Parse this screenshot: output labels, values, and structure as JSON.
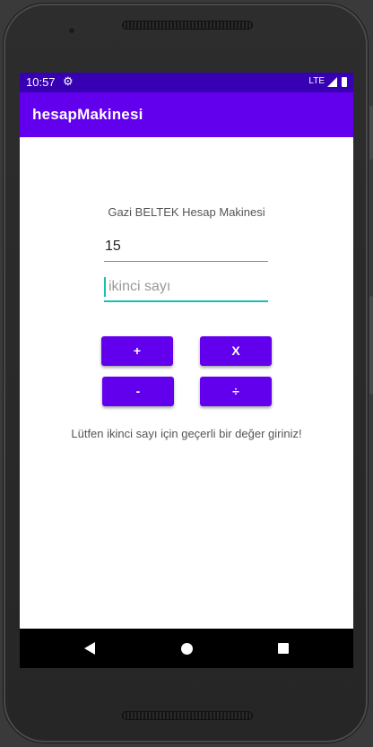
{
  "status_bar": {
    "time": "10:57",
    "gear_icon": "⚙",
    "network": "LTE"
  },
  "app_bar": {
    "title": "hesapMakinesi"
  },
  "main": {
    "heading": "Gazi BELTEK Hesap Makinesi",
    "first_number": {
      "value": "15"
    },
    "second_number": {
      "placeholder": "ikinci sayı",
      "value": ""
    },
    "buttons": {
      "add": "+",
      "multiply": "X",
      "subtract": "-",
      "divide": "÷"
    },
    "message": "Lütfen ikinci sayı için geçerli bir değer giriniz!"
  },
  "colors": {
    "status_bar": "#3700b3",
    "app_bar": "#6200ee",
    "button": "#6200ee",
    "focus_accent": "#18c0b4"
  }
}
